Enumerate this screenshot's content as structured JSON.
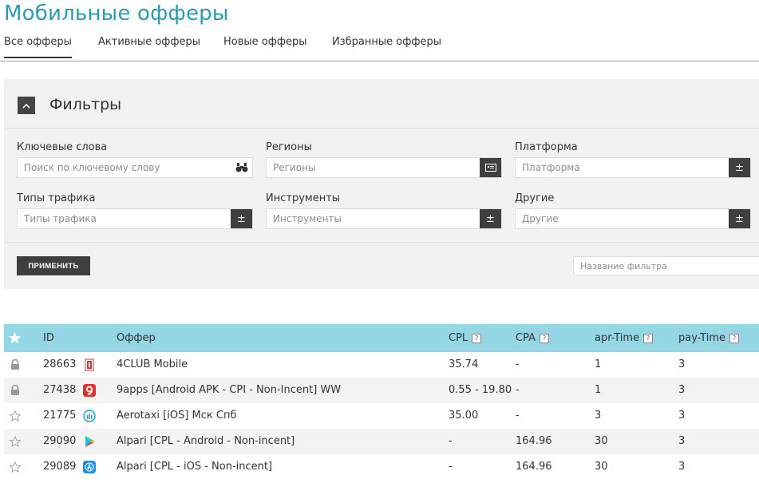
{
  "page": {
    "title": "Мобильные офферы"
  },
  "tabs": [
    {
      "label": "Все офферы",
      "active": true
    },
    {
      "label": "Активные офферы",
      "active": false
    },
    {
      "label": "Новые офферы",
      "active": false
    },
    {
      "label": "Избранные офферы",
      "active": false
    }
  ],
  "filters": {
    "title": "Фильтры",
    "keywords": {
      "label": "Ключевые слова",
      "placeholder": "Поиск по ключевому слову"
    },
    "regions": {
      "label": "Регионы",
      "placeholder": "Регионы"
    },
    "platform": {
      "label": "Платформа",
      "placeholder": "Платформа"
    },
    "traffic": {
      "label": "Типы трафика",
      "placeholder": "Типы трафика"
    },
    "tools": {
      "label": "Инструменты",
      "placeholder": "Инструменты"
    },
    "other": {
      "label": "Другие",
      "placeholder": "Другие"
    },
    "pm_symbol": "±",
    "apply_label": "ПРИМЕНИТЬ",
    "filter_name_placeholder": "Название фильтра"
  },
  "table": {
    "header": {
      "id": "ID",
      "offer": "Оффер",
      "cpl": "CPL",
      "cpa": "CPA",
      "apr": "apr-Time",
      "pay": "pay-Time",
      "help": "?"
    },
    "rows": [
      {
        "fav": "lock",
        "id": "28663",
        "icon": "4club-icon",
        "offer": "4CLUB Mobile",
        "cpl": "35.74",
        "cpa": "-",
        "apr": "1",
        "pay": "3"
      },
      {
        "fav": "lock",
        "id": "27438",
        "icon": "9apps-icon",
        "offer": "9apps [Android APK - CPI - Non-Incent] WW",
        "cpl": "0.55 - 19.80",
        "cpa": "-",
        "apr": "1",
        "pay": "3"
      },
      {
        "fav": "star",
        "id": "21775",
        "icon": "aerotaxi-icon",
        "offer": "Aerotaxi [iOS] Мск Спб",
        "cpl": "35.00",
        "cpa": "-",
        "apr": "3",
        "pay": "3"
      },
      {
        "fav": "star",
        "id": "29090",
        "icon": "google-play-icon",
        "offer": "Alpari [CPL - Android - Non-incent]",
        "cpl": "-",
        "cpa": "164.96",
        "apr": "30",
        "pay": "3"
      },
      {
        "fav": "star",
        "id": "29089",
        "icon": "app-store-icon",
        "offer": "Alpari [CPL - iOS - Non-incent]",
        "cpl": "-",
        "cpa": "164.96",
        "apr": "30",
        "pay": "3"
      }
    ]
  },
  "colors": {
    "accent": "#2a9bb4",
    "table_header": "#95d6e5",
    "dark_button": "#3f3f3f"
  }
}
